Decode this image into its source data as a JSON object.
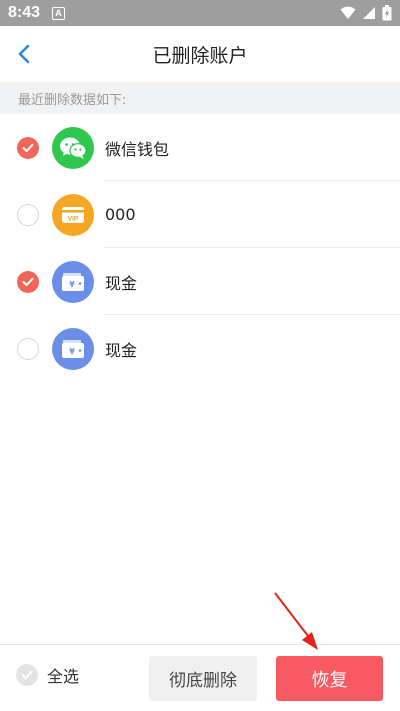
{
  "status_bar": {
    "time": "8:43",
    "notification_glyph": "A",
    "icons": [
      "wifi-icon",
      "signal-icon",
      "battery-charging-icon"
    ]
  },
  "nav": {
    "back_icon": "chevron-left-icon",
    "title": "已删除账户"
  },
  "section": {
    "header": "最近删除数据如下:"
  },
  "accounts": [
    {
      "name": "微信钱包",
      "icon": "wechat-icon",
      "icon_color": "#2dc84d",
      "checked": true
    },
    {
      "name": "000",
      "icon": "vip-card-icon",
      "icon_color": "#f5a623",
      "checked": false
    },
    {
      "name": "现金",
      "icon": "cash-wallet-icon",
      "icon_color": "#6b8ee8",
      "checked": true
    },
    {
      "name": "现金",
      "icon": "cash-wallet-icon",
      "icon_color": "#6b8ee8",
      "checked": false
    }
  ],
  "bottom_bar": {
    "select_all_label": "全选",
    "delete_label": "彻底删除",
    "restore_label": "恢复"
  },
  "colors": {
    "accent_red": "#f85a62",
    "check_red": "#f0665b",
    "nav_blue": "#1e8fe1",
    "status_bar": "#9e9e9e",
    "section_bg": "#f1f2f4"
  },
  "annotation": {
    "arrow_color": "#e5231b",
    "target": "restore-button"
  }
}
